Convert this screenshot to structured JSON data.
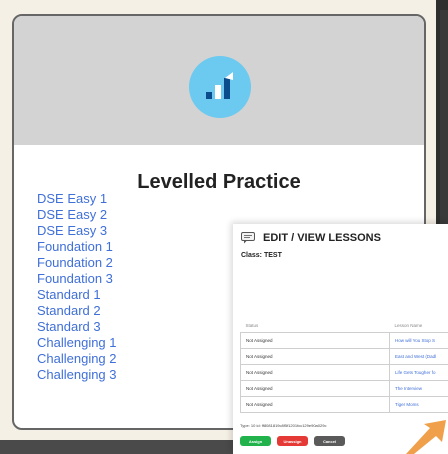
{
  "levelled_practice": {
    "title": "Levelled Practice",
    "levels": [
      "DSE Easy 1",
      "DSE Easy 2",
      "DSE Easy 3",
      "Foundation 1",
      "Foundation 2",
      "Foundation 3",
      "Standard 1",
      "Standard 2",
      "Standard 3",
      "Challenging 1",
      "Challenging 2",
      "Challenging 3"
    ],
    "colors": {
      "header_bg": "#d3d3d3",
      "logo_circle": "#6cc9ef",
      "link": "#3f6fd8"
    },
    "logo_icon": "bar-chart-icon"
  },
  "lessons_panel": {
    "title": "EDIT / VIEW LESSONS",
    "title_icon": "chat-icon",
    "class_label": "Class: TEST",
    "columns": {
      "status": "Status",
      "lesson_name": "Lesson Name"
    },
    "rows": [
      {
        "status": "Not Assigned",
        "lesson": "How will You Stop S"
      },
      {
        "status": "Not Assigned",
        "lesson": "East and West (Dadl"
      },
      {
        "status": "Not Assigned",
        "lesson": "Life Gets Tougher fo"
      },
      {
        "status": "Not Assigned",
        "lesson": "The Interview"
      },
      {
        "status": "Not Assigned",
        "lesson": "Tiger Moms"
      }
    ],
    "type_id": "Type: 10 id: ff8081819c8f5f1201fcc129e90a029c",
    "buttons": {
      "assign": "Assign",
      "unassign": "Unassign",
      "cancel": "Cancel"
    },
    "colors": {
      "assign": "#22b24c",
      "unassign": "#e53935",
      "cancel": "#5a5a5a"
    }
  }
}
